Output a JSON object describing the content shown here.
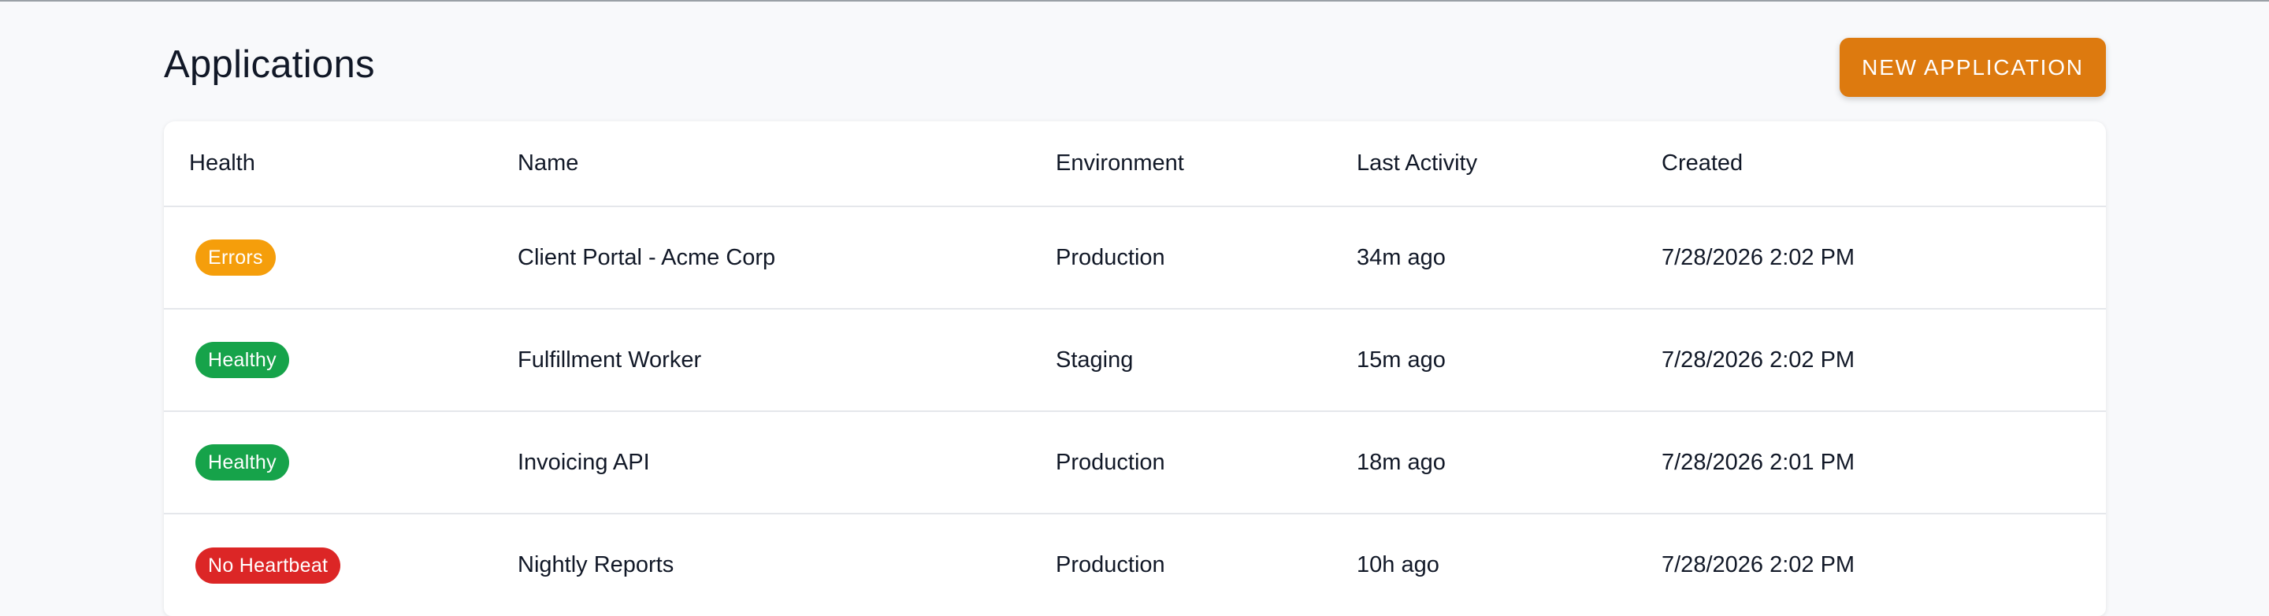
{
  "header": {
    "title": "Applications",
    "new_button_label": "NEW APPLICATION"
  },
  "table": {
    "columns": [
      "Health",
      "Name",
      "Environment",
      "Last Activity",
      "Created"
    ],
    "rows": [
      {
        "health": "Errors",
        "health_color": "#f59e0b",
        "name": "Client Portal - Acme Corp",
        "environment": "Production",
        "last_activity": "34m ago",
        "created": "7/28/2026 2:02 PM"
      },
      {
        "health": "Healthy",
        "health_color": "#16a34a",
        "name": "Fulfillment Worker",
        "environment": "Staging",
        "last_activity": "15m ago",
        "created": "7/28/2026 2:02 PM"
      },
      {
        "health": "Healthy",
        "health_color": "#16a34a",
        "name": "Invoicing API",
        "environment": "Production",
        "last_activity": "18m ago",
        "created": "7/28/2026 2:01 PM"
      },
      {
        "health": "No Heartbeat",
        "health_color": "#dc2626",
        "name": "Nightly Reports",
        "environment": "Production",
        "last_activity": "10h ago",
        "created": "7/28/2026 2:02 PM"
      }
    ]
  },
  "colors": {
    "accent": "#dd7a0f",
    "background": "#f8f9fb"
  }
}
